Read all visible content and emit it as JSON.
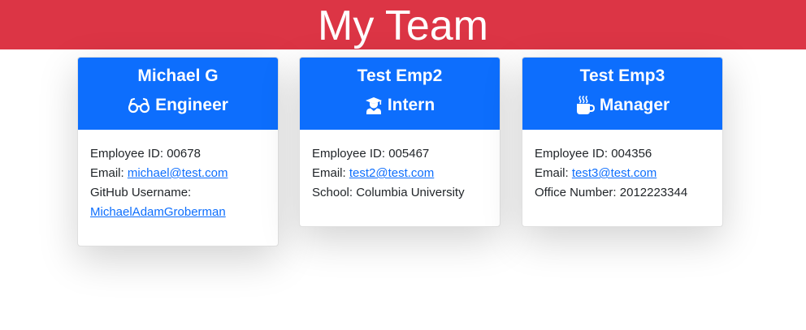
{
  "page": {
    "title": "My Team",
    "colors": {
      "banner": "#dc3545",
      "card_header": "#0d6efd",
      "link": "#0d6efd"
    }
  },
  "team": [
    {
      "name": "Michael G",
      "role": "Engineer",
      "role_icon": "glasses-icon",
      "id_label": "Employee ID: 00678",
      "email_prefix": "Email: ",
      "email": "michael@test.com",
      "extra_label": "GitHub Username:",
      "extra_value": "MichaelAdamGroberman"
    },
    {
      "name": "Test Emp2",
      "role": "Intern",
      "role_icon": "user-graduate-icon",
      "id_label": "Employee ID: 005467",
      "email_prefix": "Email: ",
      "email": "test2@test.com",
      "extra_label": "School: Columbia University"
    },
    {
      "name": "Test Emp3",
      "role": "Manager",
      "role_icon": "mug-hot-icon",
      "id_label": "Employee ID: 004356",
      "email_prefix": "Email: ",
      "email": "test3@test.com",
      "extra_label": "Office Number: 2012223344"
    }
  ]
}
